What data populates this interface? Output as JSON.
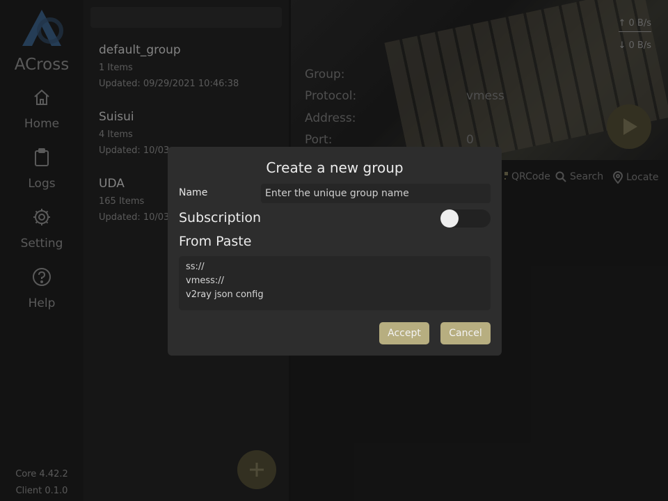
{
  "app": {
    "title": "ACross"
  },
  "sidebar": {
    "items": [
      {
        "label": "Home",
        "icon": "home-icon"
      },
      {
        "label": "Logs",
        "icon": "clipboard-icon"
      },
      {
        "label": "Setting",
        "icon": "gear-icon"
      },
      {
        "label": "Help",
        "icon": "help-icon"
      }
    ],
    "core_version": "Core 4.42.2",
    "client_version": "Client 0.1.0"
  },
  "groups": [
    {
      "name": "default_group",
      "count": "1 Items",
      "updated": "Updated: 09/29/2021 10:46:38"
    },
    {
      "name": "Suisui",
      "count": "4 Items",
      "updated": "Updated: 10/03"
    },
    {
      "name": "UDA",
      "count": "165 Items",
      "updated": "Updated: 10/03"
    }
  ],
  "status": {
    "upload": "↑ 0 B/s",
    "download": "↓ 0 B/s"
  },
  "node_info": {
    "group_label": "Group:",
    "protocol_label": "Protocol:",
    "protocol_value": "vmess",
    "address_label": "Address:",
    "port_label": "Port:",
    "port_value": "0"
  },
  "tools": [
    {
      "label": "QRCode",
      "icon": "qrcode-icon"
    },
    {
      "label": "Search",
      "icon": "search-icon"
    },
    {
      "label": "Locate",
      "icon": "location-pin-icon"
    }
  ],
  "dialog": {
    "title": "Create a new group",
    "name_label": "Name",
    "name_placeholder": "Enter the unique group name",
    "subscription_label": "Subscription",
    "subscription_on": false,
    "paste_label": "From Paste",
    "paste_lines": [
      "ss://",
      "vmess://",
      "v2ray json config"
    ],
    "accept_label": "Accept",
    "cancel_label": "Cancel"
  },
  "colors": {
    "accent": "#b7ae80",
    "dialog_bg": "#2d2d2d",
    "background": "#1b1b1b"
  }
}
